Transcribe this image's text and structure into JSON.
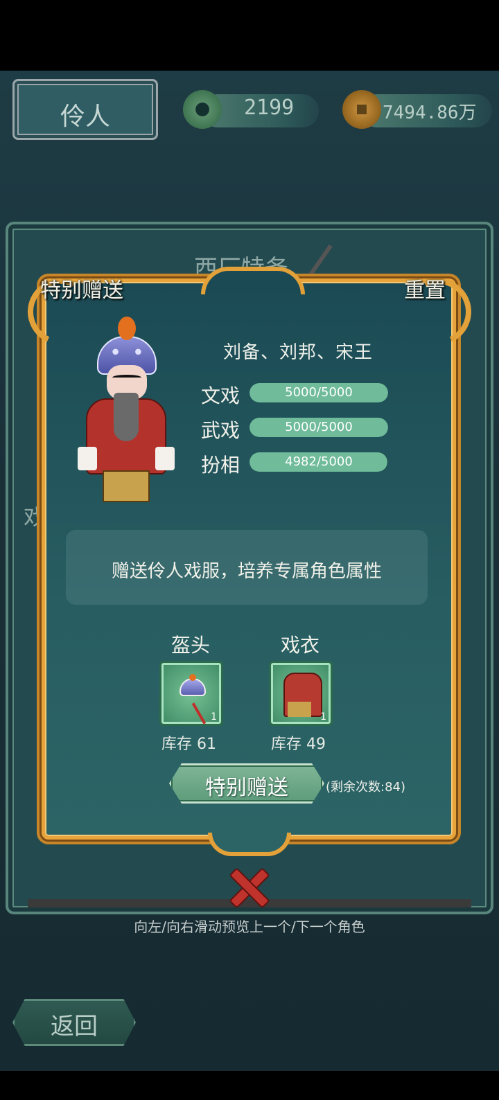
{
  "header": {
    "title": "伶人",
    "jade_amount": "2199",
    "copper_amount": "7494.86万"
  },
  "background": {
    "card_title": "西厂特务",
    "side_char": "戏"
  },
  "dialog": {
    "tab_left": "特别赠送",
    "tab_right": "重置",
    "character_names": "刘备、刘邦、宋王",
    "stats": [
      {
        "label": "文戏",
        "value": "5000/5000",
        "fraction": 1.0
      },
      {
        "label": "武戏",
        "value": "5000/5000",
        "fraction": 1.0
      },
      {
        "label": "扮相",
        "value": "4982/5000",
        "fraction": 0.9964
      }
    ],
    "description": "赠送伶人戏服，培养专属角色属性",
    "items": [
      {
        "title": "盔头",
        "count": "1",
        "stock": "库存 61",
        "icon": "headdress-icon"
      },
      {
        "title": "戏衣",
        "count": "1",
        "stock": "库存 49",
        "icon": "robe-icon"
      }
    ],
    "gift_button": "特别赠送",
    "remaining": "(剩余次数:84)"
  },
  "hint": "向左/向右滑动预览上一个/下一个角色",
  "back_button": "返回",
  "colors": {
    "gold_frame": "#e7a43a",
    "stat_fill": "#6fbb9a",
    "close_red": "#c0322c",
    "panel_teal": "#285e62"
  }
}
